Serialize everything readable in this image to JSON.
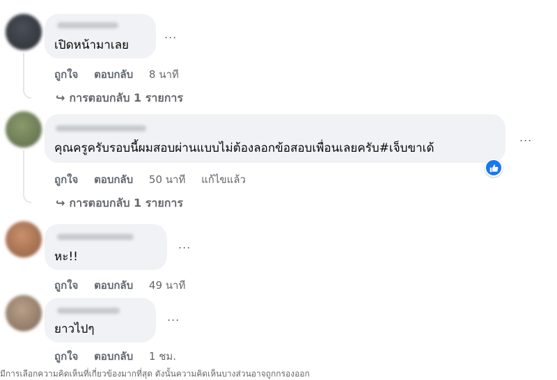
{
  "comments": [
    {
      "text": "เปิดหน้ามาเลย",
      "more": "...",
      "like": "ถูกใจ",
      "reply": "ตอบกลับ",
      "time": "8 นาที",
      "edited": "",
      "replies": "การตอบกลับ 1 รายการ"
    },
    {
      "text": "คุณครูครับรอบนี้ผมสอบผ่านแบบไม่ต้องลอกข้อสอบเพื่อนเลยครับ#เจ็บขาเด้",
      "more": "...",
      "like": "ถูกใจ",
      "reply": "ตอบกลับ",
      "time": "50 นาที",
      "edited": "แก้ไขแล้ว",
      "replies": "การตอบกลับ 1 รายการ",
      "reaction_icon": "like-icon"
    },
    {
      "text": "หะ!!",
      "more": "...",
      "like": "ถูกใจ",
      "reply": "ตอบกลับ",
      "time": "49 นาที"
    },
    {
      "text": "ยาวไปๆ",
      "more": "...",
      "like": "ถูกใจ",
      "reply": "ตอบกลับ",
      "time": "1 ชม."
    }
  ],
  "footnote": "มีการเลือกความคิดเห็นที่เกี่ยวข้องมากที่สุด ดังนั้นความคิดเห็นบางส่วนอาจถูกกรองออก",
  "colors": {
    "bubble": "#f0f2f5",
    "meta_text": "#65676b",
    "like_badge": "#1877f2"
  }
}
